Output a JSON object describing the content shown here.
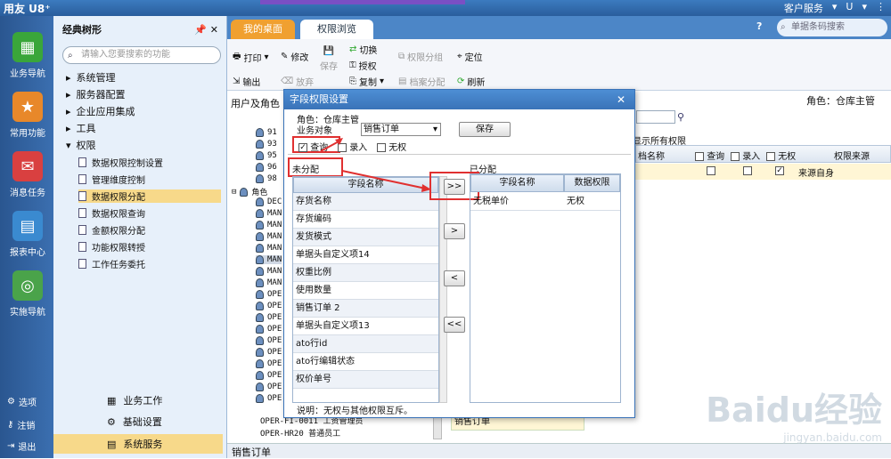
{
  "app": {
    "brand": "用友 U8⁺",
    "topright": [
      "客户服务",
      "▾",
      "U",
      "▾",
      "⋮"
    ]
  },
  "leftbar": {
    "items": [
      "业务导航",
      "常用功能",
      "消息任务",
      "报表中心",
      "实施导航"
    ],
    "bottom": [
      "选项",
      "注销",
      "退出"
    ]
  },
  "tree": {
    "title": "经典树形",
    "search_placeholder": "请输入您要搜索的功能",
    "nodes": [
      "系统管理",
      "服务器配置",
      "企业应用集成",
      "工具",
      "权限"
    ],
    "children": [
      "数据权限控制设置",
      "管理维度控制",
      "数据权限分配",
      "数据权限查询",
      "金额权限分配",
      "功能权限转授",
      "工作任务委托"
    ],
    "groups": [
      "业务工作",
      "基础设置",
      "系统服务"
    ]
  },
  "tabs": {
    "desktop": "我的桌面",
    "current": "权限浏览",
    "help": "?",
    "barcode_placeholder": "单据条码搜索"
  },
  "toolbar": {
    "print": "打印",
    "output": "输出",
    "edit": "修改",
    "discard": "放弃",
    "save": "保存",
    "switch": "切换",
    "grant": "授权",
    "copy": "复制",
    "perm_group": "权限分组",
    "doc_assign": "档案分配",
    "locate": "定位",
    "refresh": "刷新"
  },
  "sub": {
    "left": "用户及角色",
    "right": "角色：仓库主管"
  },
  "bggrid": {
    "show_all": "显示所有权限",
    "headers": [
      "档名称",
      "查询",
      "录入",
      "无权",
      "权限来源"
    ],
    "row_source": "来源自身"
  },
  "treelist": {
    "rows": [
      "91",
      "93",
      "95",
      "96",
      "98",
      "角色",
      "DEC",
      "MAN",
      "MAN",
      "MAN",
      "MAN",
      "MAN",
      "MAN",
      "MAN",
      "OPE",
      "OPE",
      "OPE",
      "OPE",
      "OPE",
      "OPE",
      "OPE",
      "OPE",
      "OPE",
      "OPE"
    ],
    "last1": "OPER-FI-0011  工资管理员",
    "last2": "OPER-HR20  普通员工"
  },
  "dialog": {
    "title": "字段权限设置",
    "role": "角色：仓库主管",
    "biz_label": "业务对象",
    "biz_value": "销售订单",
    "save": "保存",
    "cb_query": "查询",
    "cb_entry": "录入",
    "cb_none": "无权",
    "unassigned": "未分配",
    "assigned": "已分配",
    "left_header": "字段名称",
    "left_rows": [
      "存货名称",
      "存货编码",
      "发货模式",
      "单据头自定义项14",
      "权重比例",
      "使用数量",
      "销售订单 2",
      "单据头自定义项13",
      "ato行id",
      "ato行编辑状态",
      "权价单号"
    ],
    "right_headers": [
      "字段名称",
      "数据权限"
    ],
    "right_rows": [
      {
        "name": "无税单价",
        "perm": "无权"
      }
    ],
    "btns": [
      ">>",
      ">",
      "<",
      "<<"
    ],
    "note": "说明：无权与其他权限互斥。"
  },
  "bottom_item": "销售订单",
  "status": "销售订单",
  "watermark": "Baidu经验",
  "watermark_url": "jingyan.baidu.com"
}
